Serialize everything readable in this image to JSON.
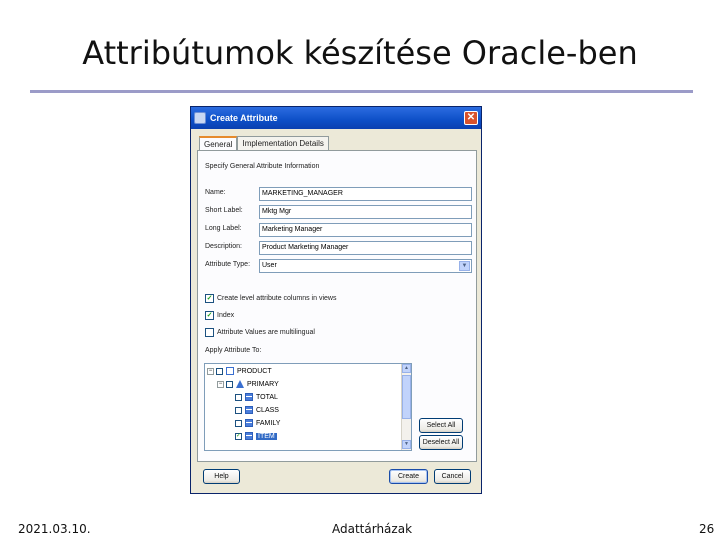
{
  "slide": {
    "title": "Attribútumok készítése Oracle-ben",
    "footer_date": "2021.03.10.",
    "footer_center": "Adattárházak",
    "footer_page": "26"
  },
  "dialog": {
    "title": "Create Attribute",
    "close_glyph": "✕",
    "tabs": [
      {
        "label": "General",
        "active": true
      },
      {
        "label": "Implementation Details",
        "active": false
      }
    ],
    "section_caption": "Specify General Attribute Information",
    "fields": {
      "name_label": "Name:",
      "name_value": "MARKETING_MANAGER",
      "short_label": "Short Label:",
      "short_value": "Mktg Mgr",
      "long_label": "Long Label:",
      "long_value": "Marketing Manager",
      "description_label": "Description:",
      "description_value": "Product Marketing Manager",
      "type_label": "Attribute Type:",
      "type_value": "User"
    },
    "checkboxes": [
      {
        "label": "Create level attribute columns in views",
        "checked": true
      },
      {
        "label": "Index",
        "checked": true
      },
      {
        "label": "Attribute Values are multilingual",
        "checked": false
      }
    ],
    "apply_caption": "Apply Attribute To:",
    "tree": [
      {
        "label": "PRODUCT",
        "expander": "−",
        "icon": "dim",
        "checked": false
      },
      {
        "label": "PRIMARY",
        "expander": "−",
        "icon": "hier",
        "checked": false
      },
      {
        "label": "TOTAL",
        "icon": "level",
        "checked": false
      },
      {
        "label": "CLASS",
        "icon": "level",
        "checked": false
      },
      {
        "label": "FAMILY",
        "icon": "level",
        "checked": false
      },
      {
        "label": "ITEM",
        "icon": "level",
        "checked": true,
        "selected": true
      }
    ],
    "buttons": {
      "select_all": "Select All",
      "deselect_all": "Deselect All",
      "help": "Help",
      "create": "Create",
      "cancel": "Cancel"
    },
    "colors": {
      "titlebar": "#0d4fc7",
      "tab_highlight": "#e68b2c",
      "selection": "#316ac5",
      "check": "#21a121"
    }
  }
}
